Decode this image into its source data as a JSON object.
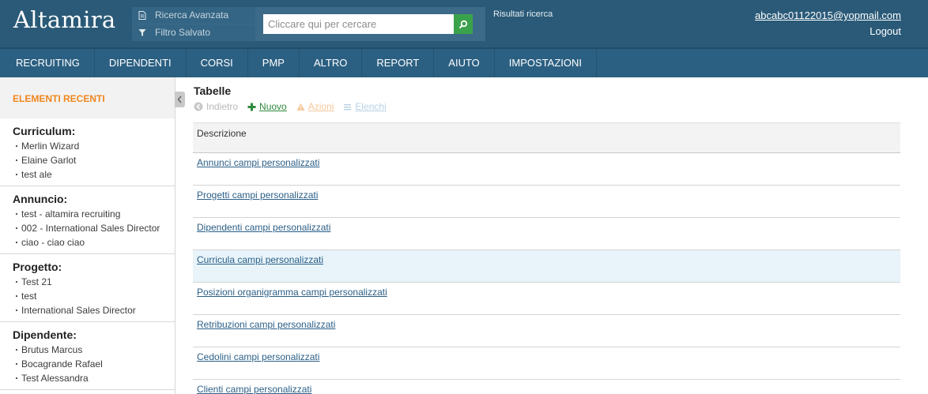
{
  "header": {
    "logo": "Altamira",
    "advanced_search_label": "Ricerca Avanzata",
    "saved_filter_label": "Filtro Salvato",
    "search_placeholder": "Cliccare qui per cercare",
    "search_value": "",
    "results_label": "Risultati ricerca",
    "user_email": "abcabc01122015@yopmail.com",
    "logout_label": "Logout",
    "accent_color": "#2a5a78"
  },
  "nav": {
    "items": [
      {
        "label": "RECRUITING"
      },
      {
        "label": "DIPENDENTI"
      },
      {
        "label": "CORSI"
      },
      {
        "label": "PMP"
      },
      {
        "label": "ALTRO"
      },
      {
        "label": "REPORT"
      },
      {
        "label": "AIUTO"
      },
      {
        "label": "IMPOSTAZIONI"
      }
    ]
  },
  "sidebar": {
    "title": "ELEMENTI RECENTI",
    "groups": [
      {
        "title": "Curriculum:",
        "items": [
          "Merlin Wizard",
          "Elaine Garlot",
          "test ale"
        ]
      },
      {
        "title": "Annuncio:",
        "items": [
          "test - altamira recruiting",
          "002 - International Sales Director",
          "ciao - ciao ciao"
        ]
      },
      {
        "title": "Progetto:",
        "items": [
          "Test 21",
          "test",
          "International Sales Director"
        ]
      },
      {
        "title": "Dipendente:",
        "items": [
          "Brutus Marcus",
          "Bocagrande Rafael",
          "Test Alessandra"
        ]
      }
    ]
  },
  "main": {
    "title": "Tabelle",
    "toolbar": {
      "back_label": "Indietro",
      "new_label": "Nuovo",
      "actions_label": "Azioni",
      "lists_label": "Elenchi"
    },
    "table": {
      "column_header": "Descrizione",
      "rows": [
        "Annunci campi personalizzati",
        "Progetti campi personalizzati",
        "Dipendenti campi personalizzati",
        "Curricula campi personalizzati",
        "Posizioni organigramma campi personalizzati",
        "Retribuzioni campi personalizzati",
        "Cedolini campi personalizzati",
        "Clienti campi personalizzati"
      ],
      "highlighted_row": 3
    }
  }
}
